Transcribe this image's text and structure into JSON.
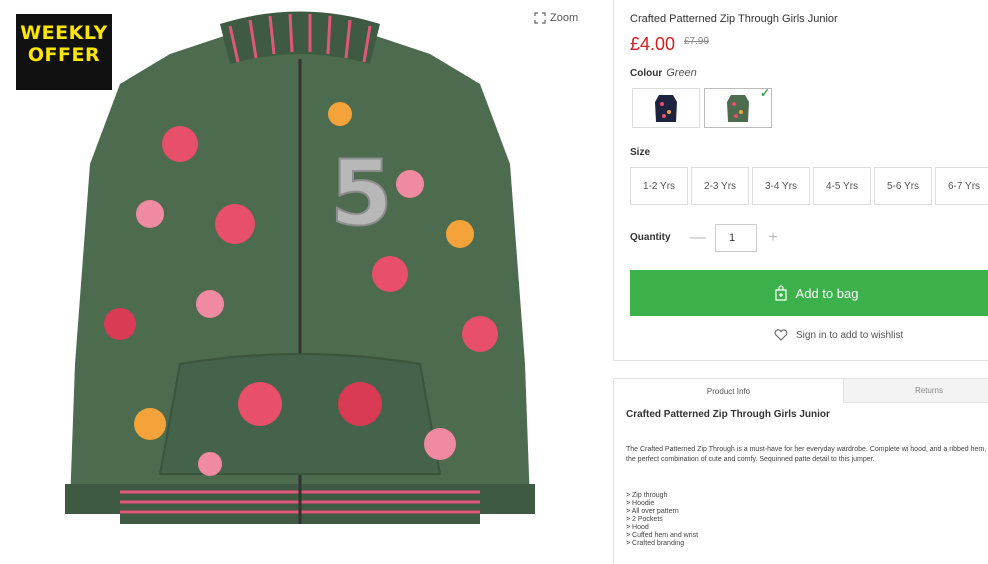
{
  "badge": {
    "line1": "WEEKLY",
    "line2": "OFFER"
  },
  "zoom": {
    "label": "Zoom"
  },
  "product": {
    "title": "Crafted Patterned Zip Through Girls Junior",
    "price": "£4.00",
    "was_price": "£7.99",
    "colour_label": "Colour",
    "colour_value": "Green"
  },
  "size": {
    "label": "Size",
    "options": [
      "1-2 Yrs",
      "2-3 Yrs",
      "3-4 Yrs",
      "4-5 Yrs",
      "5-6 Yrs",
      "6-7 Yrs"
    ]
  },
  "quantity": {
    "label": "Quantity",
    "value": "1"
  },
  "actions": {
    "add_to_bag": "Add to bag",
    "wishlist": "Sign in to add to wishlist"
  },
  "info": {
    "tabs": [
      "Product Info",
      "Returns"
    ],
    "title": "Crafted Patterned Zip Through Girls Junior",
    "description": "The Crafted Patterned Zip Through is a must-have for her everyday wardrobe. Complete wi hood, and a ribbed hem, this is the perfect combination of cute and comfy. Sequinned patte detail to this jumper.",
    "features": [
      "> Zip through",
      "> Hoodie",
      "> All over pattern",
      "> 2 Pockets",
      "> Hood",
      "> Cuffed hem and wrist",
      "> Crafted branding"
    ]
  },
  "colors": {
    "accent_green": "#3cb04b",
    "price_red": "#d21e1e",
    "badge_bg": "#111111",
    "badge_text": "#ffe600",
    "jacket_green": "#4c6b4f",
    "rib_pink": "#e0577a"
  }
}
